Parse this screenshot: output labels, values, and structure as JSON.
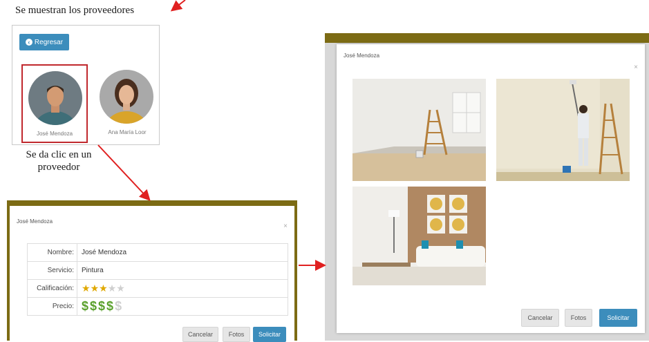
{
  "annotations": {
    "top": "Se muestran los proveedores",
    "click_line1": "Se da clic en un",
    "click_line2": "proveedor"
  },
  "provider_list": {
    "back_label": "Regresar",
    "providers": [
      {
        "name": "José Mendoza",
        "selected": true
      },
      {
        "name": "Ana María Loor",
        "selected": false
      }
    ]
  },
  "detail_modal": {
    "title": "José Mendoza",
    "close": "×",
    "rows": [
      {
        "label": "Nombre:",
        "value": "José Mendoza"
      },
      {
        "label": "Servicio:",
        "value": "Pintura"
      },
      {
        "label": "Calificación:",
        "rating_stars": 3,
        "rating_max": 5
      },
      {
        "label": "Precio:",
        "price_level": 4,
        "price_max": 5
      }
    ],
    "buttons": {
      "cancel": "Cancelar",
      "photos": "Fotos",
      "request": "Solicitar"
    }
  },
  "photos_modal": {
    "title": "José Mendoza",
    "close": "×",
    "photos": [
      "empty-room-ladder",
      "painter-on-ladder",
      "living-room"
    ],
    "buttons": {
      "cancel": "Cancelar",
      "photos": "Fotos",
      "request": "Solicitar"
    }
  },
  "colors": {
    "accent": "#3c8dbc",
    "header_bar": "#7c6b14",
    "arrow": "#e02020",
    "selected_border": "#c0282d",
    "star": "#e0a800",
    "dollar": "#5aa02c"
  }
}
